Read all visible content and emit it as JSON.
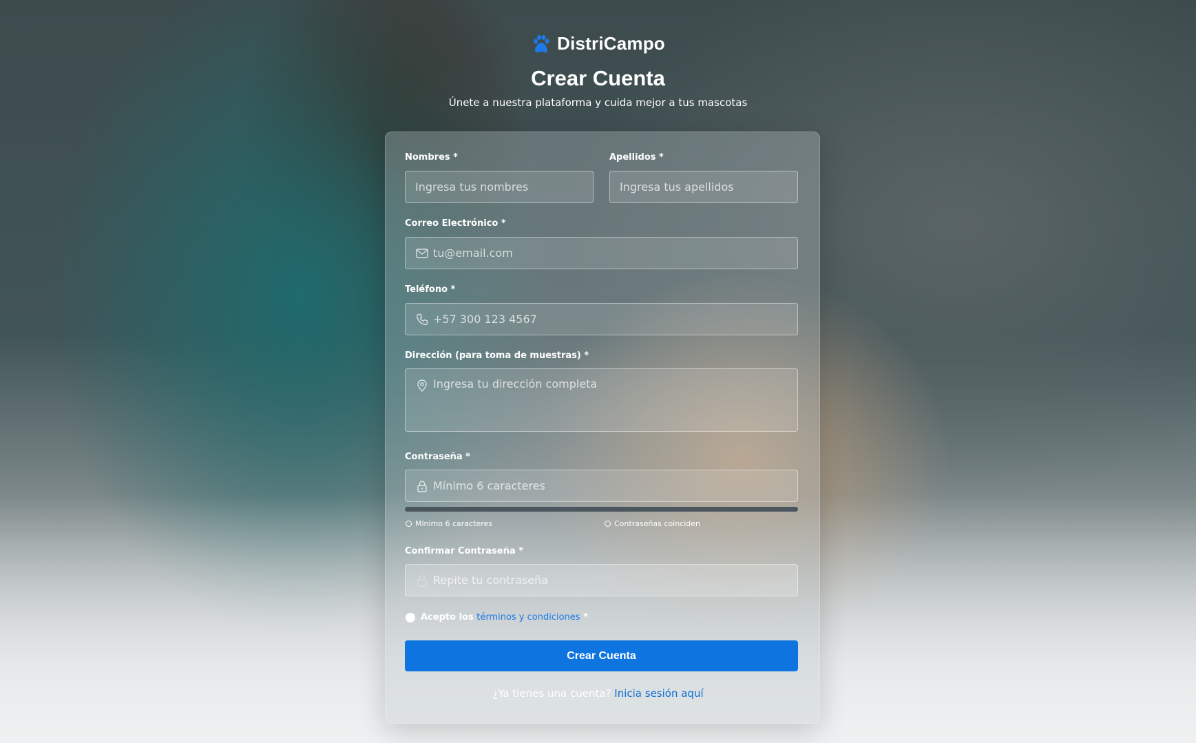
{
  "brand": {
    "name": "DistriCampo",
    "icon": "paw-icon",
    "accent": "#1e78e6"
  },
  "header": {
    "title": "Crear Cuenta",
    "subtitle": "Únete a nuestra plataforma y cuida mejor a tus mascotas"
  },
  "form": {
    "first_name": {
      "label": "Nombres *",
      "placeholder": "Ingresa tus nombres"
    },
    "last_name": {
      "label": "Apellidos *",
      "placeholder": "Ingresa tus apellidos"
    },
    "email": {
      "label": "Correo Electrónico *",
      "placeholder": "tu@email.com",
      "icon": "mail-icon"
    },
    "phone": {
      "label": "Teléfono *",
      "placeholder": "+57 300 123 4567",
      "icon": "phone-icon"
    },
    "address": {
      "label": "Dirección (para toma de muestras) *",
      "placeholder": "Ingresa tu dirección completa",
      "icon": "location-pin-icon"
    },
    "password": {
      "label": "Contraseña *",
      "placeholder": "Mínimo 6 caracteres",
      "icon": "lock-icon",
      "strength": 0
    },
    "rules": [
      {
        "text": "Mínimo 6 caracteres",
        "met": false
      },
      {
        "text": "Contraseñas coinciden",
        "met": false
      }
    ],
    "confirm_password": {
      "label": "Confirmar Contraseña *",
      "placeholder": "Repite tu contraseña"
    },
    "terms": {
      "prefix": "Acepto los",
      "link": "términos y condiciones",
      "suffix": "*",
      "checked": false
    },
    "submit_label": "Crear Cuenta"
  },
  "footer": {
    "prompt": "¿Ya tienes una cuenta?",
    "link": "Inicia sesión aquí"
  }
}
